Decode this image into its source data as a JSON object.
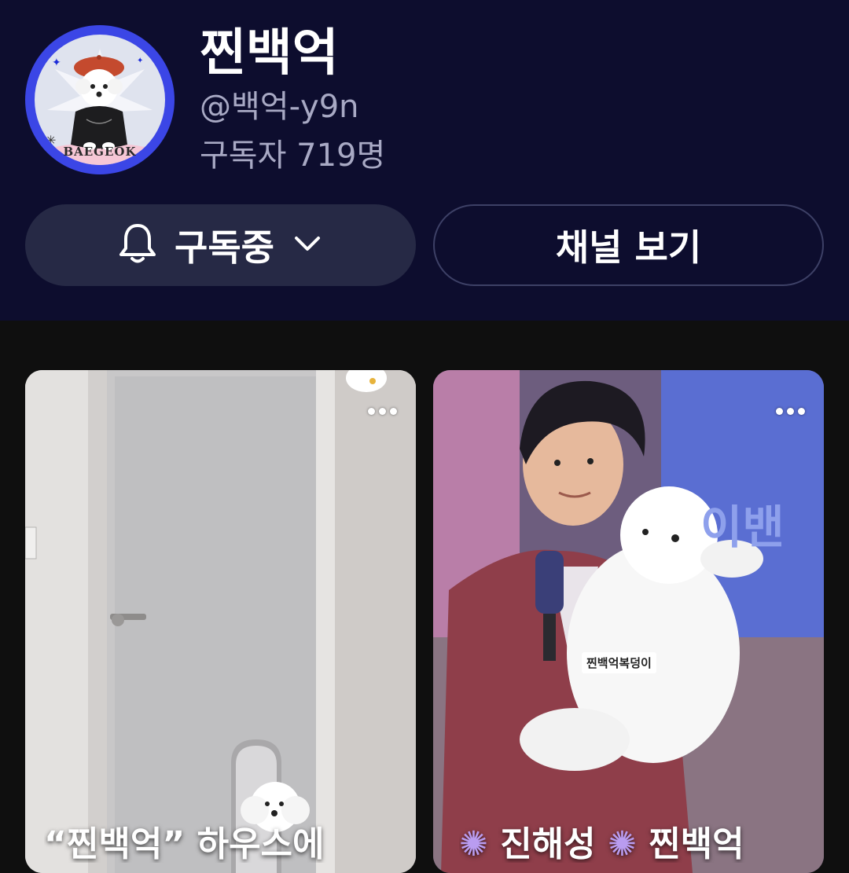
{
  "channel": {
    "name": "찐백억",
    "handle": "@백억-y9n",
    "subscribers": "구독자 719명",
    "avatar_caption": "BAEGEOK"
  },
  "actions": {
    "subscribed_label": "구독중",
    "view_channel_label": "채널 보기"
  },
  "icons": {
    "bell": "bell-icon",
    "chevron": "chevron-down-icon",
    "more": "more-horizontal-icon"
  },
  "shorts": [
    {
      "title": "“찐백억” 하우스에"
    },
    {
      "title": "진해성",
      "title2": "찐백억",
      "sticker": "찐백억복덩이"
    }
  ],
  "colors": {
    "header_bg": "#0d0d2e",
    "page_bg": "#0f0f0f",
    "subscribed_button_bg": "#262945",
    "secondary_text": "#a8a9c4",
    "avatar_ring": "#3b46e6"
  }
}
